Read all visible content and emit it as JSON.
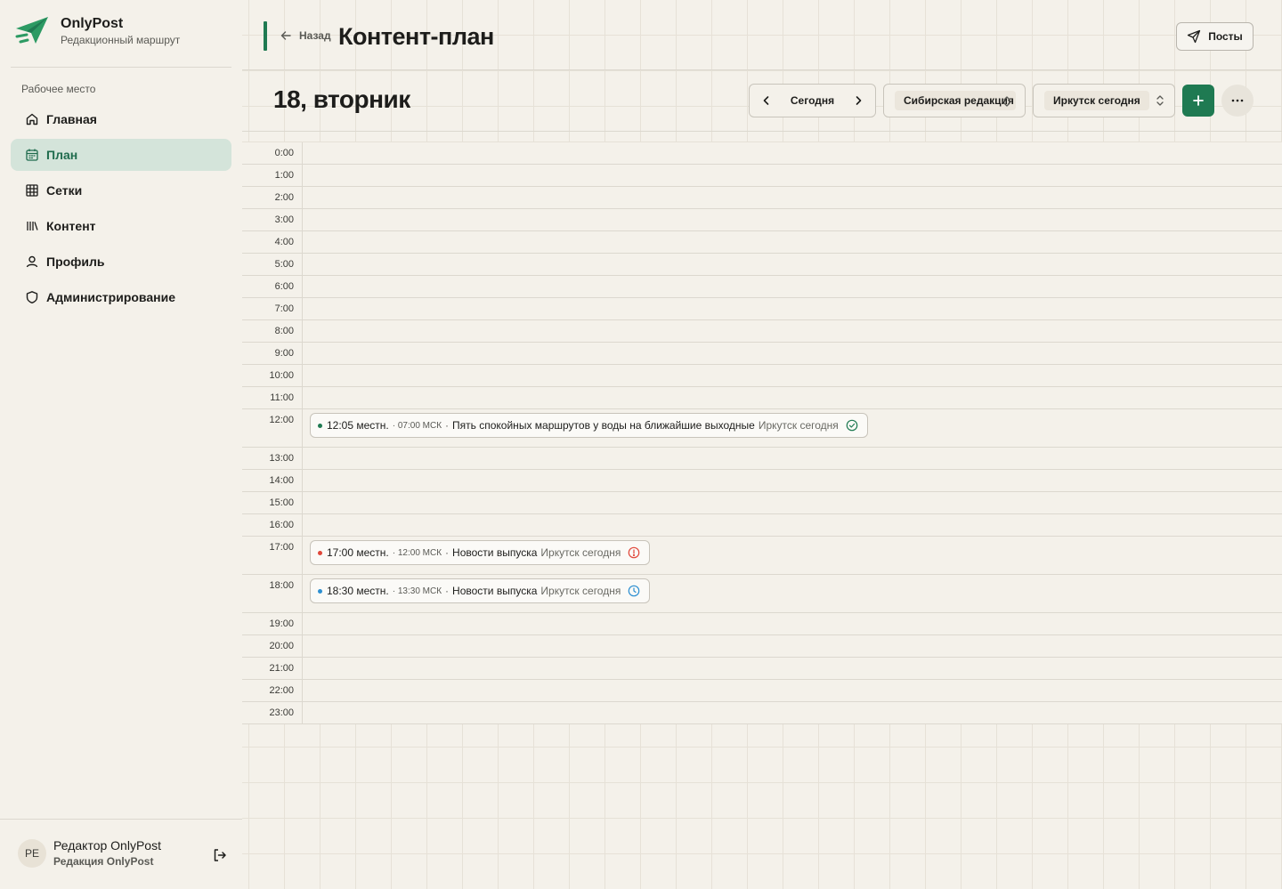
{
  "brand": {
    "name": "OnlyPost",
    "subtitle": "Редакционный маршрут"
  },
  "sidebar": {
    "section_label": "Рабочее место",
    "items": [
      {
        "label": "Главная",
        "icon": "home-icon",
        "active": false
      },
      {
        "label": "План",
        "icon": "calendar-icon",
        "active": true
      },
      {
        "label": "Сетки",
        "icon": "grid-icon",
        "active": false
      },
      {
        "label": "Контент",
        "icon": "library-icon",
        "active": false
      },
      {
        "label": "Профиль",
        "icon": "user-icon",
        "active": false
      },
      {
        "label": "Администрирование",
        "icon": "shield-icon",
        "active": false
      }
    ]
  },
  "user": {
    "initials": "PE",
    "name": "Редактор OnlyPost",
    "org": "Редакция OnlyPost"
  },
  "header": {
    "back_label": "Назад",
    "title": "Контент-план",
    "posts_label": "Посты"
  },
  "toolbar": {
    "day_title": "18, вторник",
    "today_label": "Сегодня",
    "editorial_select": "Сибирская редакция",
    "channel_select": "Иркутск сегодня"
  },
  "colors": {
    "accent": "#1f7a52",
    "active_nav_bg": "#d4e4da",
    "status_published": "#1f7a52",
    "status_error": "#e0473a",
    "status_scheduled": "#2d8fd1"
  },
  "timeline": {
    "hours": [
      "0:00",
      "1:00",
      "2:00",
      "3:00",
      "4:00",
      "5:00",
      "6:00",
      "7:00",
      "8:00",
      "9:00",
      "10:00",
      "11:00",
      "12:00",
      "13:00",
      "14:00",
      "15:00",
      "16:00",
      "17:00",
      "18:00",
      "19:00",
      "20:00",
      "21:00",
      "22:00",
      "23:00"
    ],
    "events": [
      {
        "hour_index": 12,
        "local_time": "12:05 местн.",
        "msk_time": "· 07:00 МСК",
        "title": "Пять спокойных маршрутов у воды на ближайшие выходные",
        "channel": "Иркутск сегодня",
        "status": "published",
        "dot_color": "#1f7a52",
        "status_icon": "check-circle-icon"
      },
      {
        "hour_index": 17,
        "local_time": "17:00 местн.",
        "msk_time": "· 12:00 МСК",
        "title": "Новости выпуска",
        "channel": "Иркутск сегодня",
        "status": "error",
        "dot_color": "#e0473a",
        "status_icon": "alert-circle-icon"
      },
      {
        "hour_index": 18,
        "local_time": "18:30 местн.",
        "msk_time": "· 13:30 МСК",
        "title": "Новости выпуска",
        "channel": "Иркутск сегодня",
        "status": "scheduled",
        "dot_color": "#2d8fd1",
        "status_icon": "clock-icon"
      }
    ]
  }
}
